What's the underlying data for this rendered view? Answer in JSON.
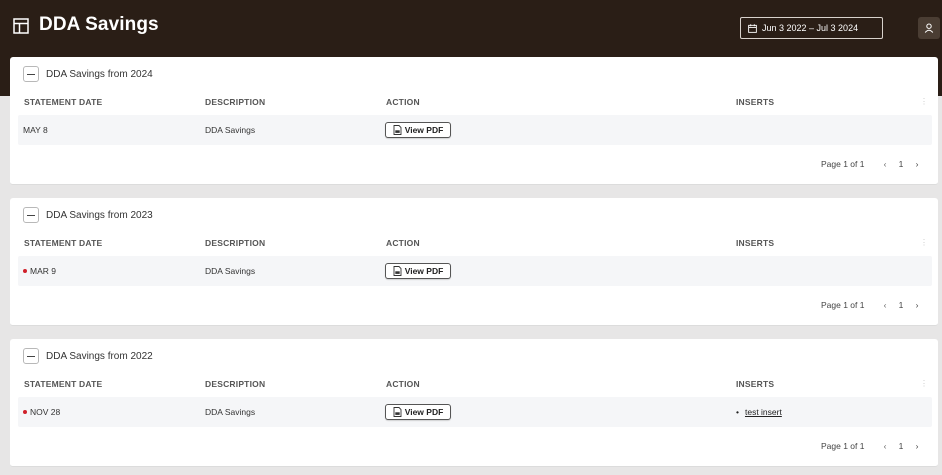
{
  "header": {
    "title": "DDA Savings",
    "date_range": "Jun 3 2022 – Jul 3 2024",
    "icons": [
      "layout-icon",
      "calendar-icon",
      "user-icon"
    ]
  },
  "columns": [
    "STATEMENT DATE",
    "DESCRIPTION",
    "ACTION",
    "INSERTS"
  ],
  "cards": [
    {
      "title": "DDA Savings from 2024",
      "rows": [
        {
          "date": "MAY 8",
          "unread": false,
          "description": "DDA Savings",
          "action": "View PDF",
          "inserts": []
        }
      ],
      "pager": {
        "text": "Page 1 of 1",
        "current": "1"
      }
    },
    {
      "title": "DDA Savings from 2023",
      "rows": [
        {
          "date": "MAR 9",
          "unread": true,
          "description": "DDA Savings",
          "action": "View PDF",
          "inserts": []
        }
      ],
      "pager": {
        "text": "Page 1 of 1",
        "current": "1"
      }
    },
    {
      "title": "DDA Savings from 2022",
      "rows": [
        {
          "date": "NOV 28",
          "unread": true,
          "description": "DDA Savings",
          "action": "View PDF",
          "inserts": [
            "test insert"
          ]
        }
      ],
      "pager": {
        "text": "Page 1 of 1",
        "current": "1"
      }
    }
  ],
  "colors": {
    "header_bg": "#2a1e16",
    "unread_dot": "#d0202a",
    "page_bg": "#e7e6e6"
  }
}
